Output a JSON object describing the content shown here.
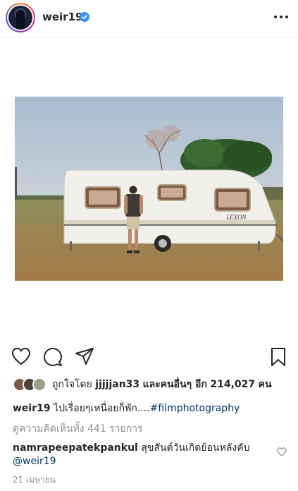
{
  "post": {
    "username": "weir19",
    "likes_prefix": "ถูกใจโดย",
    "liker_name": "jjjjjan33",
    "likes_middle": "และคนอื่นๆ อีก",
    "likes_count": "214,027",
    "likes_suffix": "คน",
    "caption_user": "weir19",
    "caption_text": "ไปเรื่อยๆเหนื่อยก็พัก....",
    "caption_hashtag": "#filmphotography",
    "view_comments": "ดูความคิดเห็นทั้ง 441 รายการ",
    "comment_user": "namrapeepatekpankul",
    "comment_text": "สุขสันต์วันเกิดย้อนหลังคับ",
    "comment_mention": "@weir19",
    "timestamp": "21 เมษายน"
  },
  "photo": {
    "trailer_brand": "LEXON"
  },
  "colors": {
    "text": "#262626",
    "muted": "#8e8e8e",
    "link": "#003569",
    "verified": "#3897f0"
  }
}
